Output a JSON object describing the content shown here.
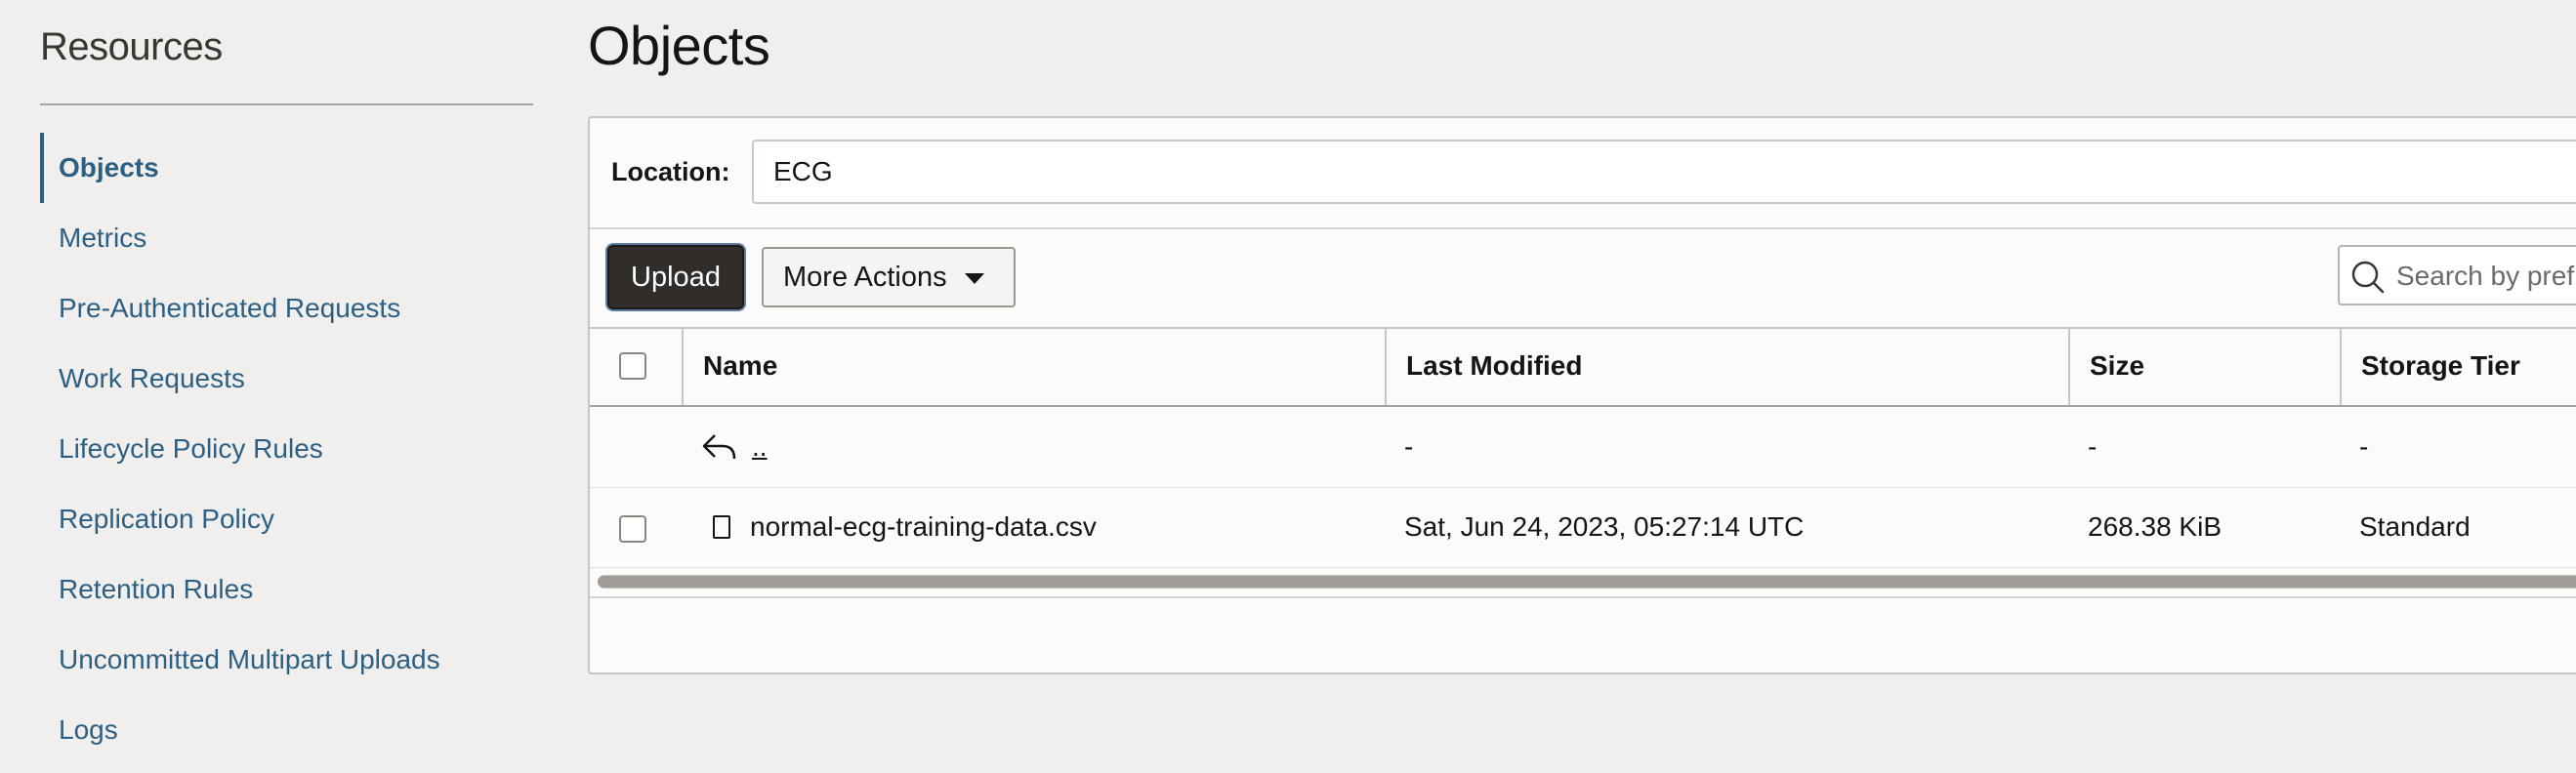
{
  "sidebar": {
    "title": "Resources",
    "items": [
      {
        "label": "Objects",
        "active": true
      },
      {
        "label": "Metrics"
      },
      {
        "label": "Pre-Authenticated Requests"
      },
      {
        "label": "Work Requests"
      },
      {
        "label": "Lifecycle Policy Rules"
      },
      {
        "label": "Replication Policy"
      },
      {
        "label": "Retention Rules"
      },
      {
        "label": "Uncommitted Multipart Uploads"
      },
      {
        "label": "Logs"
      }
    ]
  },
  "main": {
    "title": "Objects",
    "location_label": "Location:",
    "location_value": "ECG",
    "upload_label": "Upload",
    "more_actions_label": "More Actions",
    "search_placeholder": "Search by prefix",
    "columns": [
      "Name",
      "Last Modified",
      "Size",
      "Storage Tier"
    ],
    "parent_row": {
      "name": "..",
      "last_modified": "-",
      "size": "-",
      "storage_tier": "-"
    },
    "rows": [
      {
        "name": "normal-ecg-training-data.csv",
        "last_modified": "Sat, Jun 24, 2023, 05:27:14 UTC",
        "size": "268.38 KiB",
        "storage_tier": "Standard"
      }
    ]
  },
  "colors": {
    "link": "#2c5f84",
    "primary_button": "#312d2a",
    "background": "#f0efed"
  },
  "icons": {
    "search": "search-icon",
    "parent": "reply-arrow-icon",
    "file": "file-icon",
    "caret": "caret-down-icon"
  }
}
